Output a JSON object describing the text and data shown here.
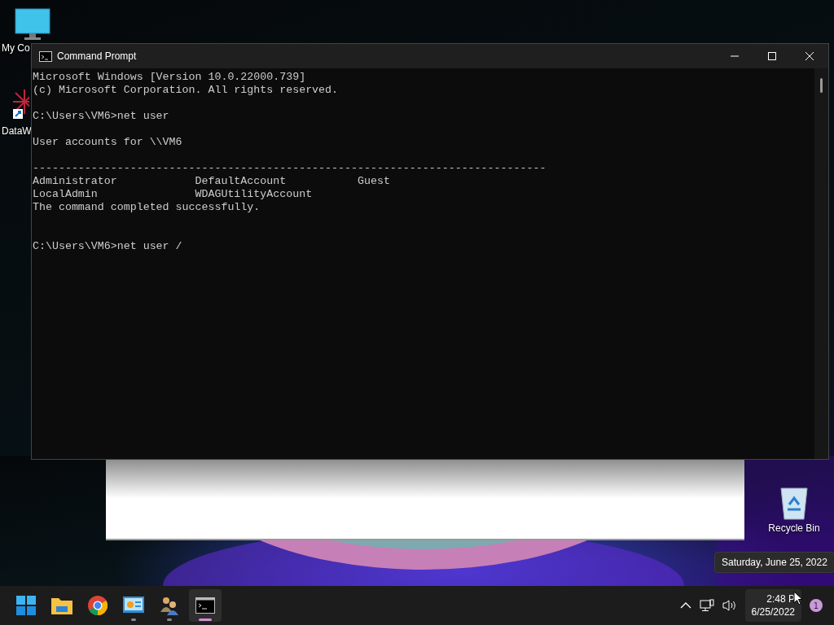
{
  "desktop_icons": [
    {
      "label": "My Co",
      "kind": "monitor"
    },
    {
      "label": "DataW",
      "kind": "app"
    },
    {
      "label": "Recycle Bin",
      "kind": "bin"
    }
  ],
  "window": {
    "title": "Command Prompt",
    "lines": [
      {
        "kind": "text",
        "text": "Microsoft Windows [Version 10.0.22000.739]"
      },
      {
        "kind": "text",
        "text": "(c) Microsoft Corporation. All rights reserved."
      },
      {
        "kind": "blank"
      },
      {
        "kind": "text",
        "text": "C:\\Users\\VM6>net user"
      },
      {
        "kind": "blank"
      },
      {
        "kind": "text",
        "text": "User accounts for \\\\VM6"
      },
      {
        "kind": "blank"
      },
      {
        "kind": "text",
        "text": "-------------------------------------------------------------------------------"
      },
      {
        "kind": "text",
        "text": "Administrator            DefaultAccount           Guest"
      },
      {
        "kind": "text",
        "text": "LocalAdmin               WDAGUtilityAccount"
      },
      {
        "kind": "text",
        "text": "The command completed successfully."
      },
      {
        "kind": "blank"
      },
      {
        "kind": "blank"
      },
      {
        "kind": "text",
        "text": "C:\\Users\\VM6>net user /"
      }
    ]
  },
  "tooltip": "Saturday, June 25, 2022",
  "taskbar": {
    "apps": [
      {
        "kind": "start",
        "running": false,
        "active": false
      },
      {
        "kind": "folder",
        "running": false,
        "active": false
      },
      {
        "kind": "browser",
        "running": false,
        "active": false
      },
      {
        "kind": "panel",
        "running": true,
        "active": false
      },
      {
        "kind": "users",
        "running": true,
        "active": false
      },
      {
        "kind": "console",
        "running": true,
        "active": true
      }
    ],
    "time": "2:48 P",
    "date": "6/25/2022",
    "notifications": "1"
  }
}
